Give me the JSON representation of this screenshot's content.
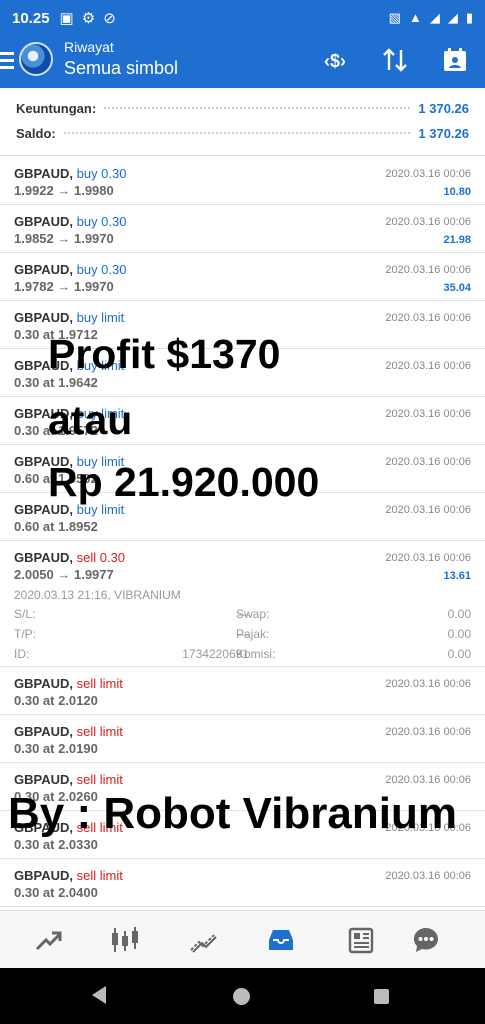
{
  "status": {
    "time": "10.25",
    "left_icons": [
      "image-icon",
      "usb-icon",
      "blocked-icon"
    ],
    "right_icons": [
      "vibrate-icon",
      "wifi-icon",
      "signal-icon",
      "signal-icon",
      "battery-icon"
    ]
  },
  "header": {
    "subtitle": "Riwayat",
    "title": "Semua simbol",
    "actions": [
      "currency-exchange-icon",
      "sort-icon",
      "calendar-icon"
    ]
  },
  "summary": {
    "profit_label": "Keuntungan:",
    "profit_value": "1 370.26",
    "balance_label": "Saldo:",
    "balance_value": "1 370.26"
  },
  "orders": [
    {
      "symbol": "GBPAUD,",
      "side": "buy 0.30",
      "prices": "1.9922 → 1.9980",
      "date": "2020.03.16 00:06",
      "profit": "10.80"
    },
    {
      "symbol": "GBPAUD,",
      "side": "buy 0.30",
      "prices": "1.9852 → 1.9970",
      "date": "2020.03.16 00:06",
      "profit": "21.98"
    },
    {
      "symbol": "GBPAUD,",
      "side": "buy 0.30",
      "prices": "1.9782 → 1.9970",
      "date": "2020.03.16 00:06",
      "profit": "35.04"
    },
    {
      "symbol": "GBPAUD,",
      "side": "buy limit",
      "prices": "0.30 at 1.9712",
      "date": "2020.03.16 00:06",
      "profit": ""
    },
    {
      "symbol": "GBPAUD,",
      "side": "buy limit",
      "prices": "0.30 at 1.9642",
      "date": "2020.03.16 00:06",
      "profit": ""
    },
    {
      "symbol": "GBPAUD,",
      "side": "buy limit",
      "prices": "0.30 at 1.9572",
      "date": "2020.03.16 00:06",
      "profit": ""
    },
    {
      "symbol": "GBPAUD,",
      "side": "buy limit",
      "prices": "0.60 at 1.9502",
      "date": "2020.03.16 00:06",
      "profit": ""
    },
    {
      "symbol": "GBPAUD,",
      "side": "buy limit",
      "prices": "0.60 at 1.8952",
      "date": "2020.03.16 00:06",
      "profit": ""
    }
  ],
  "expanded_order": {
    "symbol": "GBPAUD,",
    "side": "sell 0.30",
    "prices": "2.0050 → 1.9977",
    "date": "2020.03.16 00:06",
    "profit": "13.61",
    "open_time": "2020.03.13 21:16, VIBRANIUM",
    "sl_label": "S/L:",
    "sl_value": "—",
    "swap_label": "Swap:",
    "swap_value": "0.00",
    "tp_label": "T/P:",
    "tp_value": "—",
    "tax_label": "Pajak:",
    "tax_value": "0.00",
    "id_label": "ID:",
    "id_value": "1734220691",
    "commission_label": "Komisi:",
    "commission_value": "0.00"
  },
  "sell_orders": [
    {
      "symbol": "GBPAUD,",
      "side": "sell limit",
      "prices": "0.30 at 2.0120",
      "date": "2020.03.16 00:06"
    },
    {
      "symbol": "GBPAUD,",
      "side": "sell limit",
      "prices": "0.30 at 2.0190",
      "date": "2020.03.16 00:06"
    },
    {
      "symbol": "GBPAUD,",
      "side": "sell limit",
      "prices": "0.30 at 2.0260",
      "date": "2020.03.16 00:06"
    },
    {
      "symbol": "GBPAUD,",
      "side": "sell limit",
      "prices": "0.30 at 2.0330",
      "date": "2020.03.16 00:06"
    },
    {
      "symbol": "GBPAUD,",
      "side": "sell limit",
      "prices": "0.30 at 2.0400",
      "date": "2020.03.16 00:06"
    }
  ],
  "overlay": {
    "line1": "Profit $1370",
    "line2": "atau",
    "line3": "Rp 21.920.000",
    "footer": "By : Robot Vibranium"
  },
  "nav": {
    "items": [
      "trade-icon",
      "chart-icon",
      "analysis-icon",
      "history-icon",
      "news-icon",
      "chat-icon"
    ],
    "active": "history-icon"
  },
  "colors": {
    "accent": "#1e6fd0",
    "sell": "#d42020",
    "buy": "#1e6fd0"
  }
}
